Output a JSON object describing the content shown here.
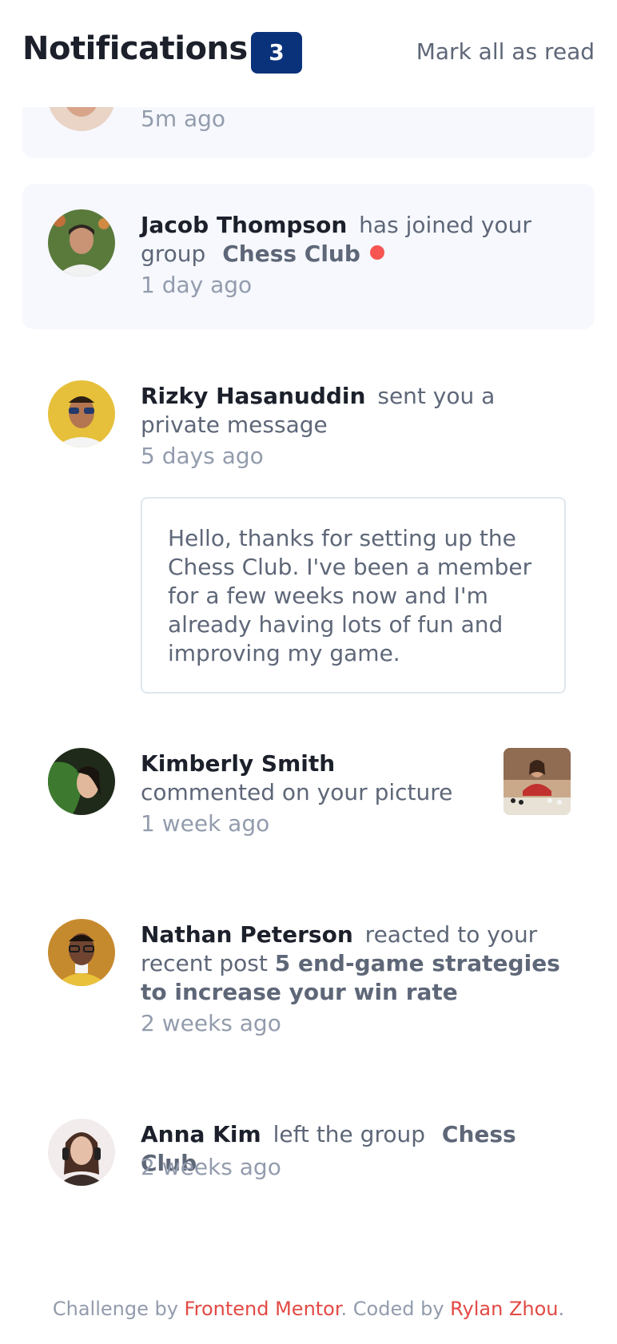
{
  "header": {
    "title": "Notifications",
    "unread_count": "3",
    "mark_all_label": "Mark all as read"
  },
  "notifications": [
    {
      "time": "5m ago"
    },
    {
      "name": "Jacob Thompson",
      "action": "has joined your group",
      "target": "Chess Club",
      "time": "1 day ago",
      "unread": true
    },
    {
      "name": "Rizky Hasanuddin",
      "action": "sent you a private message",
      "time": "5 days ago",
      "message": "Hello, thanks for setting up the Chess Club. I've been a member for a few weeks now and I'm already having lots of fun and improving my game."
    },
    {
      "name": "Kimberly Smith",
      "action": "commented on your picture",
      "time": "1 week ago"
    },
    {
      "name": "Nathan Peterson",
      "action": "reacted to your recent post",
      "target": "5 end-game strategies to increase your win rate",
      "time": "2 weeks ago"
    },
    {
      "name": "Anna Kim",
      "action": "left the group",
      "target": "Chess Club",
      "time": "2 weeks ago"
    }
  ],
  "footer": {
    "prefix": "Challenge by",
    "link1": "Frontend Mentor",
    "middle": ". Coded by",
    "link2": "Rylan Zhou",
    "suffix": "."
  },
  "colors": {
    "accent_blue": "#0a327b",
    "unread_dot": "#f65552",
    "unread_bg": "#f6f8fd",
    "link_red": "#e24a45"
  }
}
